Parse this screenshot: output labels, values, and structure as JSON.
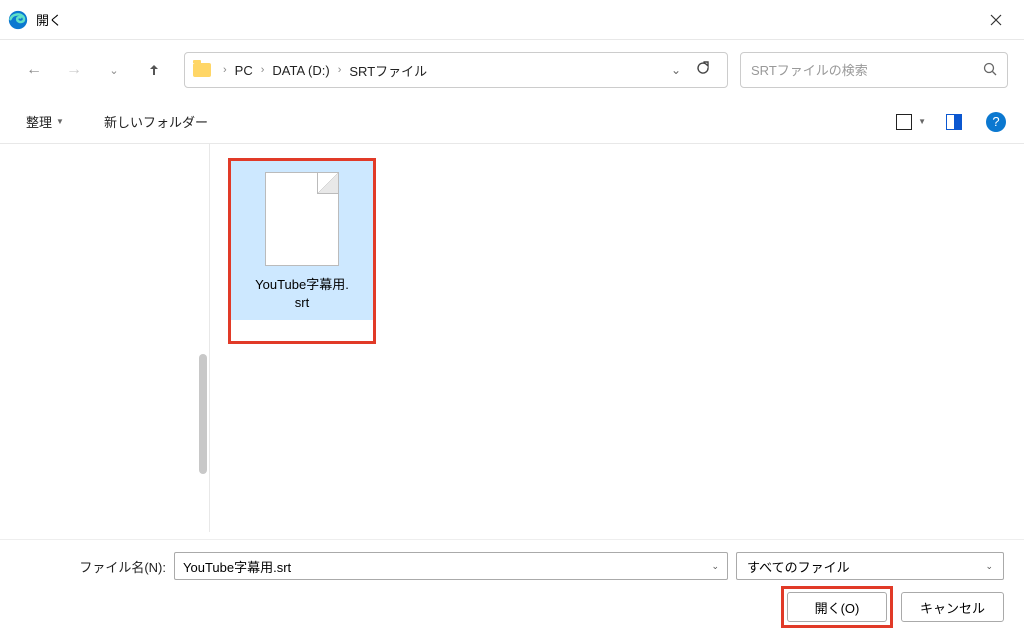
{
  "title": "開く",
  "breadcrumb": [
    "PC",
    "DATA (D:)",
    "SRTファイル"
  ],
  "search": {
    "placeholder": "SRTファイルの検索"
  },
  "toolbar": {
    "organize": "整理",
    "new_folder": "新しいフォルダー"
  },
  "files": [
    {
      "name": "YouTube字幕用.\nsrt",
      "selected": true
    }
  ],
  "filename": {
    "label": "ファイル名(N):",
    "value": "YouTube字幕用.srt"
  },
  "type_filter": "すべてのファイル",
  "buttons": {
    "open": "開く(O)",
    "cancel": "キャンセル"
  }
}
